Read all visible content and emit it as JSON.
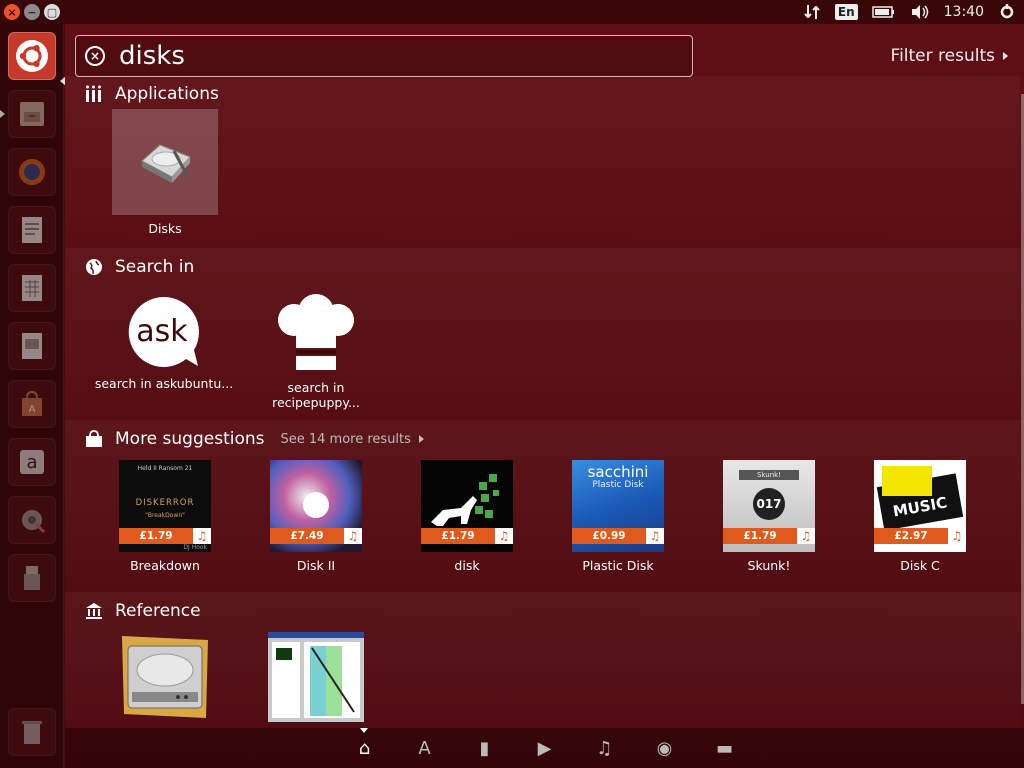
{
  "window_controls": {
    "close_icon": "close-icon",
    "minimize_icon": "minimize-icon",
    "maximize_icon": "maximize-icon"
  },
  "panel": {
    "keyboard_layout": "En",
    "clock": "13:40"
  },
  "launcher": {
    "items": [
      {
        "name": "ubuntu-dash",
        "icon": "ubuntu-logo-icon",
        "active": true
      },
      {
        "name": "files",
        "icon": "file-cabinet-icon"
      },
      {
        "name": "firefox",
        "icon": "firefox-icon"
      },
      {
        "name": "writer",
        "icon": "document-icon"
      },
      {
        "name": "calc",
        "icon": "spreadsheet-icon"
      },
      {
        "name": "impress",
        "icon": "presentation-icon"
      },
      {
        "name": "software-center",
        "icon": "shopping-bag-icon"
      },
      {
        "name": "amazon",
        "icon": "amazon-icon"
      },
      {
        "name": "system-settings",
        "icon": "gear-icon"
      },
      {
        "name": "usb-drive",
        "icon": "usb-icon"
      },
      {
        "name": "trash",
        "icon": "trash-icon"
      }
    ]
  },
  "search": {
    "query": "disks",
    "filter_label": "Filter results"
  },
  "categories": {
    "applications": {
      "title": "Applications",
      "items": [
        {
          "label": "Disks"
        }
      ]
    },
    "search_in": {
      "title": "Search in",
      "items": [
        {
          "label_line1": "search in askubuntu...",
          "label_line2": "",
          "icon_text": "ask"
        },
        {
          "label_line1": "search in",
          "label_line2": "recipepuppy...",
          "icon_text": ""
        }
      ]
    },
    "more_suggestions": {
      "title": "More suggestions",
      "see_more": "See 14 more results",
      "items": [
        {
          "label": "Breakdown",
          "price": "£1.79",
          "art_top": "Held II Ransom 21",
          "art_mid": "DISKERROR",
          "art_sub": "\"BreakDown\"",
          "art_bottom": "DJ Hook"
        },
        {
          "label": "Disk II",
          "price": "£7.49"
        },
        {
          "label": "disk",
          "price": "£1.79"
        },
        {
          "label": "Plastic Disk",
          "price": "£0.99",
          "art_top": "sacchini",
          "art_sub": "Plastic Disk"
        },
        {
          "label": "Skunk!",
          "price": "£1.79",
          "art_top": "Skunk!",
          "art_mid": "017"
        },
        {
          "label": "Disk C",
          "price": "£2.97",
          "art_mid": "MUSIC"
        }
      ]
    },
    "reference": {
      "title": "Reference",
      "items": [
        {
          "name": "hard-disk-image"
        },
        {
          "name": "disk-chart-screenshot"
        }
      ]
    }
  },
  "lenses": [
    {
      "name": "home",
      "icon": "home-icon",
      "glyph": "⌂",
      "active": true
    },
    {
      "name": "applications",
      "icon": "applications-lens-icon",
      "glyph": "A"
    },
    {
      "name": "files",
      "icon": "file-icon",
      "glyph": "▮"
    },
    {
      "name": "video",
      "icon": "video-icon",
      "glyph": "▶"
    },
    {
      "name": "music",
      "icon": "music-icon",
      "glyph": "♫"
    },
    {
      "name": "photos",
      "icon": "camera-icon",
      "glyph": "◉"
    },
    {
      "name": "social",
      "icon": "speech-bubble-icon",
      "glyph": "▬"
    }
  ],
  "colors": {
    "accent": "#e05a1e",
    "background": "#4f0b11",
    "launcher_active": "#c53a2a"
  }
}
